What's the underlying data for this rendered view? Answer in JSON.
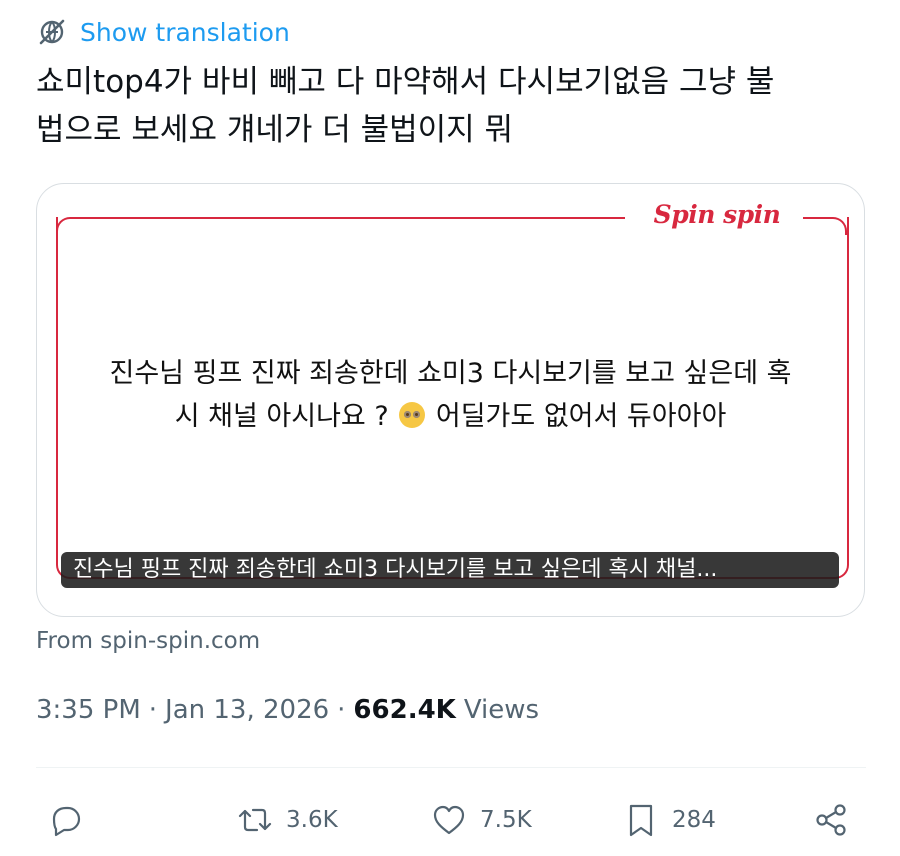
{
  "translate": {
    "label": "Show translation",
    "icon": "globe-slash-icon",
    "color": "#1d9bf0"
  },
  "tweet": {
    "text": "쇼미top4가 바비 빼고 다 마약해서 다시보기없음 그냥 불\n법으로 보세요 걔네가 더 불법이지 뭐"
  },
  "card": {
    "brand": "Spin spin",
    "accent_color": "#d8283f",
    "body_line1": "진수님 핑프 진짜 죄송한데 쇼미3 다시보기를 보고 싶은데 혹",
    "body_line2_before": "시 채널 아시나요 ?",
    "body_emoji": "pleading-face-emoji",
    "body_line2_after": "어딜가도 없어서 듀아아아",
    "caption": "진수님 핑프 진짜 죄송한데 쇼미3 다시보기를 보고 싶은데 혹시 채널..."
  },
  "source": "From spin-spin.com",
  "meta": {
    "time": "3:35 PM",
    "separator1": "·",
    "date": "Jan 13, 2026",
    "separator2": "·",
    "views_count": "662.4K",
    "views_label": "Views"
  },
  "actions": {
    "reply": {
      "icon": "reply-icon",
      "count": ""
    },
    "retweet": {
      "icon": "retweet-icon",
      "count": "3.6K"
    },
    "like": {
      "icon": "heart-icon",
      "count": "7.5K"
    },
    "bookmark": {
      "icon": "bookmark-icon",
      "count": "284"
    },
    "share": {
      "icon": "share-icon"
    }
  }
}
